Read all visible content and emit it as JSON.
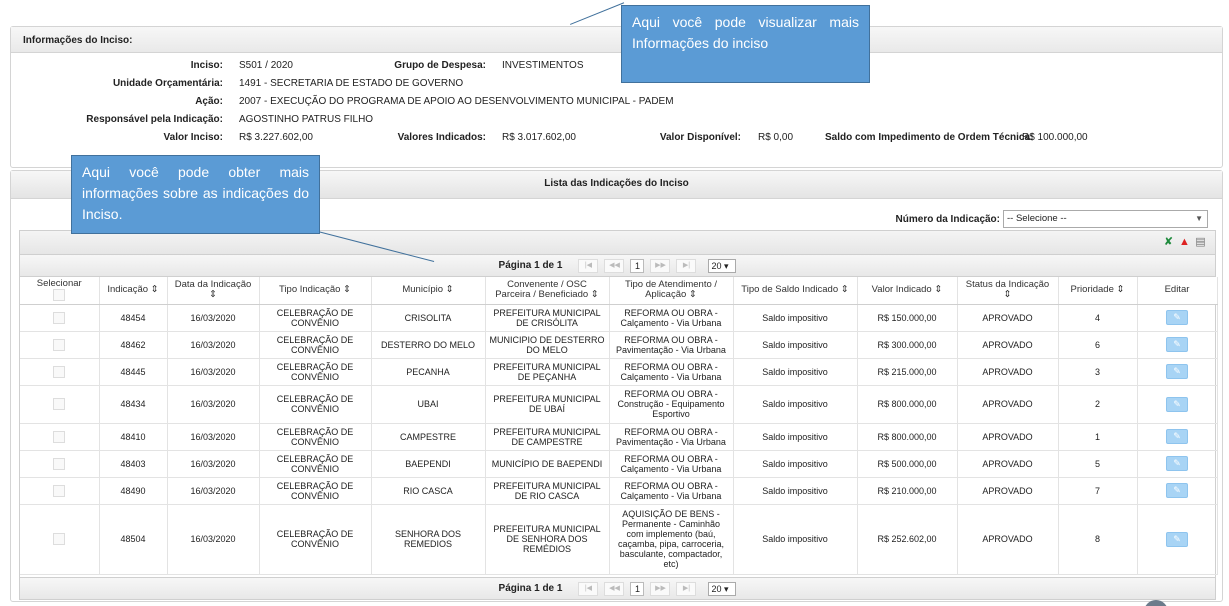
{
  "info": {
    "header": "Informações do Inciso:",
    "fields": [
      {
        "label": "Inciso:",
        "value": "S501 / 2020"
      },
      {
        "label": "Grupo de Despesa:",
        "value": "INVESTIMENTOS"
      },
      {
        "label": "Unidade Orçamentária:",
        "value": "1491 - SECRETARIA DE ESTADO DE GOVERNO"
      },
      {
        "label": "Ação:",
        "value": "2007 - EXECUÇÃO DO PROGRAMA DE APOIO AO DESENVOLVIMENTO MUNICIPAL - PADEM"
      },
      {
        "label": "Responsável pela Indicação:",
        "value": "AGOSTINHO PATRUS FILHO"
      },
      {
        "label": "Valor Inciso:",
        "value": "R$ 3.227.602,00"
      },
      {
        "label": "Valores Indicados:",
        "value": "R$ 3.017.602,00"
      },
      {
        "label": "Valor Disponível:",
        "value": "R$ 0,00"
      },
      {
        "label": "Saldo com Impedimento de Ordem Técnica:",
        "value": "R$ 100.000,00"
      }
    ]
  },
  "callouts": {
    "top": "Aqui você pode visualizar mais Informações do inciso",
    "left": "Aqui você pode obter mais informações sobre as indicações do Inciso."
  },
  "list": {
    "title": "Lista das Indicações do Inciso",
    "filter_label": "Número da Indicação:",
    "filter_value": "-- Selecione --",
    "pager": {
      "label": "Página 1 de 1",
      "page": "1",
      "size": "20"
    },
    "columns": [
      "Selecionar",
      "Indicação ⇕",
      "Data da Indicação ⇕",
      "Tipo Indicação ⇕",
      "Município ⇕",
      "Convenente / OSC Parceira / Beneficiado ⇕",
      "Tipo de Atendimento / Aplicação ⇕",
      "Tipo de Saldo Indicado ⇕",
      "Valor Indicado ⇕",
      "Status da Indicação ⇕",
      "Prioridade ⇕",
      "Editar"
    ],
    "rows": [
      {
        "indicacao": "48454",
        "data": "16/03/2020",
        "tipo": "CELEBRAÇÃO DE CONVÊNIO",
        "municipio": "CRISOLITA",
        "convenente": "PREFEITURA MUNICIPAL DE CRISÓLITA",
        "atendimento": "REFORMA OU OBRA - Calçamento - Via Urbana",
        "saldo": "Saldo impositivo",
        "valor": "R$ 150.000,00",
        "status": "APROVADO",
        "prioridade": "4"
      },
      {
        "indicacao": "48462",
        "data": "16/03/2020",
        "tipo": "CELEBRAÇÃO DE CONVÊNIO",
        "municipio": "DESTERRO DO MELO",
        "convenente": "MUNICIPIO DE DESTERRO DO MELO",
        "atendimento": "REFORMA OU OBRA - Pavimentação - Via Urbana",
        "saldo": "Saldo impositivo",
        "valor": "R$ 300.000,00",
        "status": "APROVADO",
        "prioridade": "6"
      },
      {
        "indicacao": "48445",
        "data": "16/03/2020",
        "tipo": "CELEBRAÇÃO DE CONVÊNIO",
        "municipio": "PECANHA",
        "convenente": "PREFEITURA MUNICIPAL DE PEÇANHA",
        "atendimento": "REFORMA OU OBRA - Calçamento - Via Urbana",
        "saldo": "Saldo impositivo",
        "valor": "R$ 215.000,00",
        "status": "APROVADO",
        "prioridade": "3"
      },
      {
        "indicacao": "48434",
        "data": "16/03/2020",
        "tipo": "CELEBRAÇÃO DE CONVÊNIO",
        "municipio": "UBAI",
        "convenente": "PREFEITURA MUNICIPAL DE UBAÍ",
        "atendimento": "REFORMA OU OBRA - Construção - Equipamento Esportivo",
        "saldo": "Saldo impositivo",
        "valor": "R$ 800.000,00",
        "status": "APROVADO",
        "prioridade": "2"
      },
      {
        "indicacao": "48410",
        "data": "16/03/2020",
        "tipo": "CELEBRAÇÃO DE CONVÊNIO",
        "municipio": "CAMPESTRE",
        "convenente": "PREFEITURA MUNICIPAL DE CAMPESTRE",
        "atendimento": "REFORMA OU OBRA - Pavimentação - Via Urbana",
        "saldo": "Saldo impositivo",
        "valor": "R$ 800.000,00",
        "status": "APROVADO",
        "prioridade": "1"
      },
      {
        "indicacao": "48403",
        "data": "16/03/2020",
        "tipo": "CELEBRAÇÃO DE CONVÊNIO",
        "municipio": "BAEPENDI",
        "convenente": "MUNICÍPIO DE BAEPENDI",
        "atendimento": "REFORMA OU OBRA - Calçamento - Via Urbana",
        "saldo": "Saldo impositivo",
        "valor": "R$ 500.000,00",
        "status": "APROVADO",
        "prioridade": "5"
      },
      {
        "indicacao": "48490",
        "data": "16/03/2020",
        "tipo": "CELEBRAÇÃO DE CONVÊNIO",
        "municipio": "RIO CASCA",
        "convenente": "PREFEITURA MUNICIPAL DE RIO CASCA",
        "atendimento": "REFORMA OU OBRA - Calçamento - Via Urbana",
        "saldo": "Saldo impositivo",
        "valor": "R$ 210.000,00",
        "status": "APROVADO",
        "prioridade": "7"
      },
      {
        "indicacao": "48504",
        "data": "16/03/2020",
        "tipo": "CELEBRAÇÃO DE CONVÊNIO",
        "municipio": "SENHORA DOS REMEDIOS",
        "convenente": "PREFEITURA MUNICIPAL DE SENHORA DOS REMÉDIOS",
        "atendimento": "AQUISIÇÃO DE BENS - Permanente - Caminhão com implemento (baú, caçamba, pipa, carroceria, basculante, compactador, etc)",
        "saldo": "Saldo impositivo",
        "valor": "R$ 252.602,00",
        "status": "APROVADO",
        "prioridade": "8"
      }
    ]
  },
  "icons": {
    "excel": "excel-icon",
    "pdf": "pdf-icon",
    "print": "print-icon",
    "edit": "pencil-icon"
  },
  "colors": {
    "callout": "#5b9bd5",
    "edit_button": "#a8d4f5"
  }
}
